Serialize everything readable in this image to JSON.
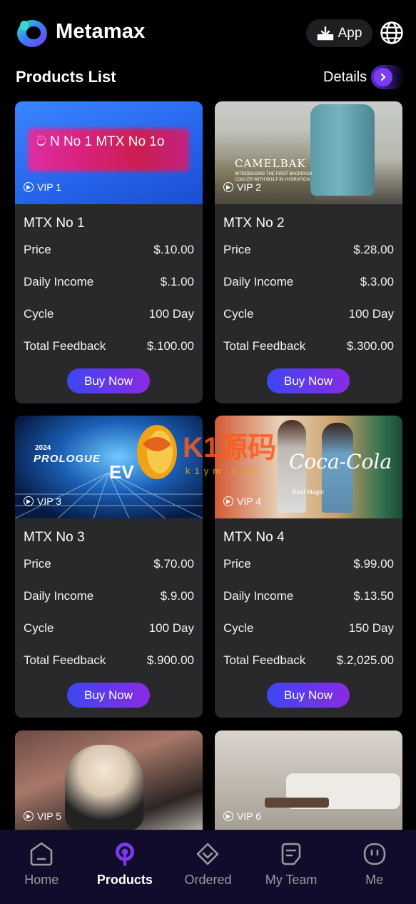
{
  "header": {
    "app_name": "Metamax",
    "app_button_label": "App",
    "globe_icon": "globe-icon"
  },
  "section": {
    "title": "Products List",
    "details_label": "Details"
  },
  "labels": {
    "price": "Price",
    "daily_income": "Daily Income",
    "cycle": "Cycle",
    "total_feedback": "Total Feedback",
    "buy_now": "Buy Now"
  },
  "products": [
    {
      "vip": "VIP 1",
      "name": "MTX No 1",
      "price": "$.10.00",
      "daily_income": "$.1.00",
      "cycle": "100 Day",
      "total_feedback": "$.100.00",
      "banner_text": "ට N No 1  MTX No 1o"
    },
    {
      "vip": "VIP 2",
      "name": "MTX No 2",
      "price": "$.28.00",
      "daily_income": "$.3.00",
      "cycle": "100 Day",
      "total_feedback": "$.300.00",
      "banner_text": "CAMELBAK",
      "banner_sub": "INTRODUCING THE FIRST BACKPACK COOLER WITH BUILT-IN HYDRATION"
    },
    {
      "vip": "VIP 3",
      "name": "MTX No 3",
      "price": "$.70.00",
      "daily_income": "$.9.00",
      "cycle": "100 Day",
      "total_feedback": "$.900.00",
      "banner_year": "2024",
      "banner_text": "PROLOGUE",
      "banner_sub": "EV"
    },
    {
      "vip": "VIP 4",
      "name": "MTX No 4",
      "price": "$.99.00",
      "daily_income": "$.13.50",
      "cycle": "150 Day",
      "total_feedback": "$.2,025.00",
      "banner_text": "Coca-Cola",
      "banner_sub": "Real Magic"
    },
    {
      "vip": "VIP 5"
    },
    {
      "vip": "VIP 6"
    }
  ],
  "watermark": {
    "text": "K1源码",
    "sub": "k1ym.com"
  },
  "nav": [
    {
      "label": "Home",
      "icon": "home-icon",
      "active": false
    },
    {
      "label": "Products",
      "icon": "products-icon",
      "active": true
    },
    {
      "label": "Ordered",
      "icon": "ordered-icon",
      "active": false
    },
    {
      "label": "My Team",
      "icon": "team-icon",
      "active": false
    },
    {
      "label": "Me",
      "icon": "me-icon",
      "active": false
    }
  ],
  "colors": {
    "accent_start": "#3d46f2",
    "accent_end": "#8a2be2",
    "card_bg": "#29292c",
    "nav_bg": "#120c2c"
  }
}
